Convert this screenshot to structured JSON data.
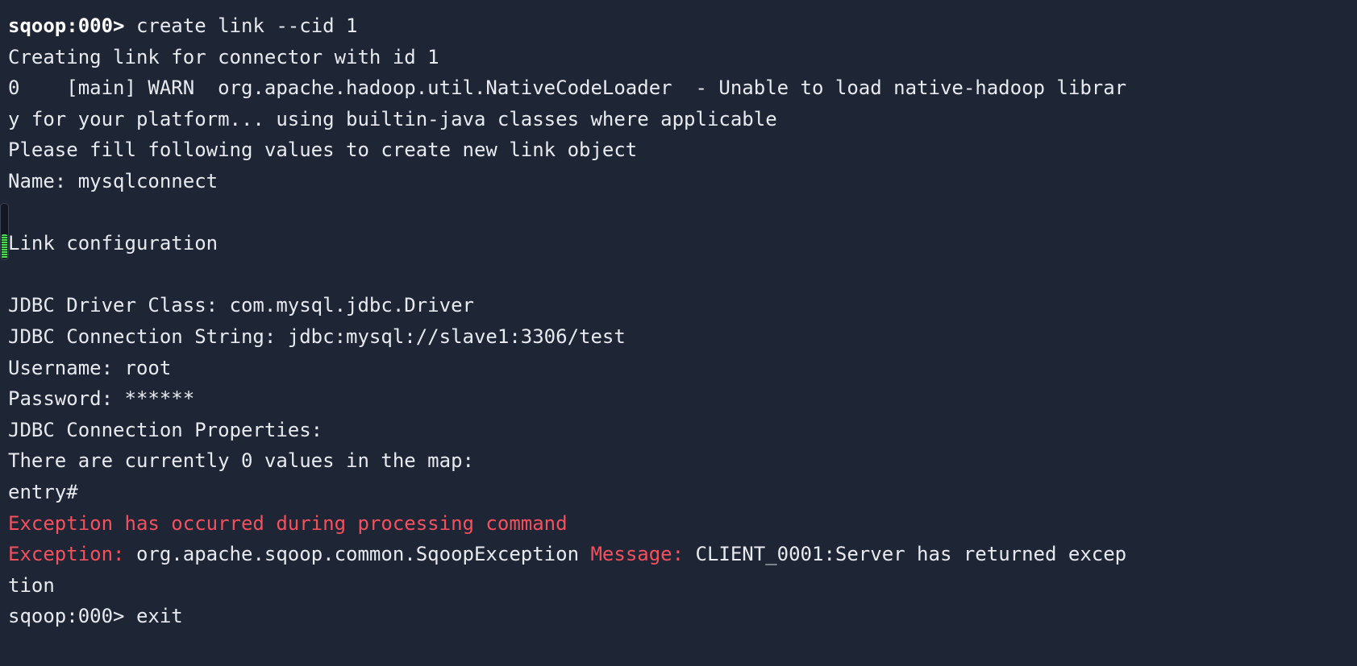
{
  "terminal": {
    "title": "sqoop shell",
    "background_color": "#1e2635",
    "foreground_color": "#e8eaef",
    "error_color": "#f4505e",
    "prompt": "sqoop:000>",
    "command": "create link --cid 1",
    "lines": [
      {
        "id": "line-prompt-create-link",
        "segments": [
          {
            "text": "sqoop:000>",
            "style": "bold"
          },
          {
            "text": " create link --cid 1",
            "style": "normal"
          }
        ]
      },
      {
        "id": "line-creating-link",
        "segments": [
          {
            "text": "Creating link for connector with id 1",
            "style": "normal"
          }
        ]
      },
      {
        "id": "line-warn-nativecodeloader",
        "segments": [
          {
            "text": "0    [main] WARN  org.apache.hadoop.util.NativeCodeLoader  - Unable to load native-hadoop librar",
            "style": "normal"
          }
        ]
      },
      {
        "id": "line-warn-nativecodeloader-wrap",
        "segments": [
          {
            "text": "y for your platform... using builtin-java classes where applicable",
            "style": "normal"
          }
        ]
      },
      {
        "id": "line-please-fill",
        "segments": [
          {
            "text": "Please fill following values to create new link object",
            "style": "normal"
          }
        ]
      },
      {
        "id": "line-name",
        "segments": [
          {
            "text": "Name: mysqlconnect",
            "style": "normal"
          }
        ]
      },
      {
        "id": "line-blank-1",
        "segments": [
          {
            "text": "",
            "style": "normal"
          }
        ]
      },
      {
        "id": "line-link-configuration",
        "segments": [
          {
            "text": "Link configuration",
            "style": "normal"
          }
        ]
      },
      {
        "id": "line-blank-2",
        "segments": [
          {
            "text": "",
            "style": "normal"
          }
        ]
      },
      {
        "id": "line-jdbc-driver-class",
        "segments": [
          {
            "text": "JDBC Driver Class: com.mysql.jdbc.Driver",
            "style": "normal"
          }
        ]
      },
      {
        "id": "line-jdbc-connection-string",
        "segments": [
          {
            "text": "JDBC Connection String: jdbc:mysql://slave1:3306/test",
            "style": "normal"
          }
        ]
      },
      {
        "id": "line-username",
        "segments": [
          {
            "text": "Username: root",
            "style": "normal"
          }
        ]
      },
      {
        "id": "line-password",
        "segments": [
          {
            "text": "Password: ******",
            "style": "normal"
          }
        ]
      },
      {
        "id": "line-jdbc-connection-properties",
        "segments": [
          {
            "text": "JDBC Connection Properties:",
            "style": "normal"
          }
        ]
      },
      {
        "id": "line-map-values-count",
        "segments": [
          {
            "text": "There are currently 0 values in the map:",
            "style": "normal"
          }
        ]
      },
      {
        "id": "line-entry-prompt",
        "segments": [
          {
            "text": "entry#",
            "style": "normal"
          }
        ]
      },
      {
        "id": "line-exception-occurred",
        "segments": [
          {
            "text": "Exception has occurred during processing command",
            "style": "red"
          }
        ]
      },
      {
        "id": "line-exception-detail",
        "segments": [
          {
            "text": "Exception:",
            "style": "red"
          },
          {
            "text": " org.apache.sqoop.common.SqoopException ",
            "style": "normal"
          },
          {
            "text": "Message:",
            "style": "red"
          },
          {
            "text": " CLIENT_0001:Server has returned excep",
            "style": "normal"
          }
        ]
      },
      {
        "id": "line-exception-detail-wrap",
        "segments": [
          {
            "text": "tion",
            "style": "normal"
          }
        ]
      },
      {
        "id": "line-prompt-clipped",
        "segments": [
          {
            "text": "sqoop:000> exit",
            "style": "normal"
          }
        ]
      }
    ]
  },
  "scrollbar": {
    "name": "vertical-scrollbar",
    "track_color": "#121722",
    "thumb_color": "#4ade55",
    "orientation": "vertical",
    "position": "left"
  }
}
